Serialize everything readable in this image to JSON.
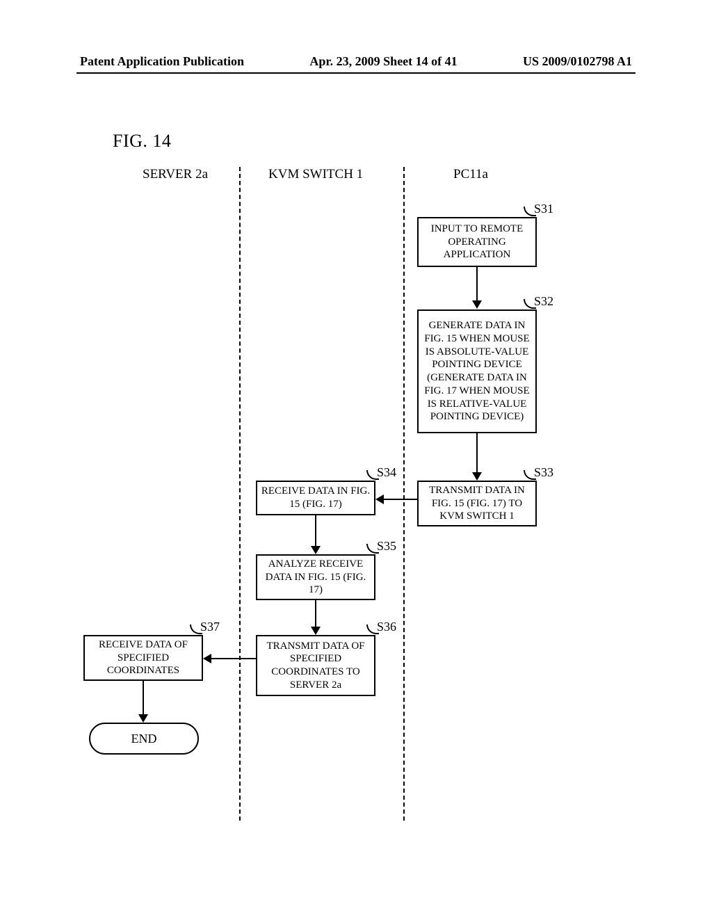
{
  "header": {
    "left": "Patent Application Publication",
    "center": "Apr. 23, 2009  Sheet 14 of 41",
    "right": "US 2009/0102798 A1"
  },
  "figure_label": "FIG. 14",
  "columns": {
    "server": "SERVER 2a",
    "kvm": "KVM SWITCH 1",
    "pc": "PC11a"
  },
  "steps": {
    "s31": {
      "label": "S31",
      "text": "INPUT TO REMOTE OPERATING APPLICATION"
    },
    "s32": {
      "label": "S32",
      "text": "GENERATE DATA IN FIG. 15 WHEN MOUSE IS ABSOLUTE-VALUE POINTING DEVICE (GENERATE DATA IN FIG. 17 WHEN MOUSE IS RELATIVE-VALUE POINTING DEVICE)"
    },
    "s33": {
      "label": "S33",
      "text": "TRANSMIT DATA IN FIG. 15 (FIG. 17) TO KVM SWITCH 1"
    },
    "s34": {
      "label": "S34",
      "text": "RECEIVE DATA IN FIG. 15 (FIG. 17)"
    },
    "s35": {
      "label": "S35",
      "text": "ANALYZE RECEIVE DATA IN FIG. 15 (FIG. 17)"
    },
    "s36": {
      "label": "S36",
      "text": "TRANSMIT DATA OF SPECIFIED COORDINATES TO SERVER 2a"
    },
    "s37": {
      "label": "S37",
      "text": "RECEIVE DATA OF SPECIFIED COORDINATES"
    }
  },
  "terminator": "END"
}
